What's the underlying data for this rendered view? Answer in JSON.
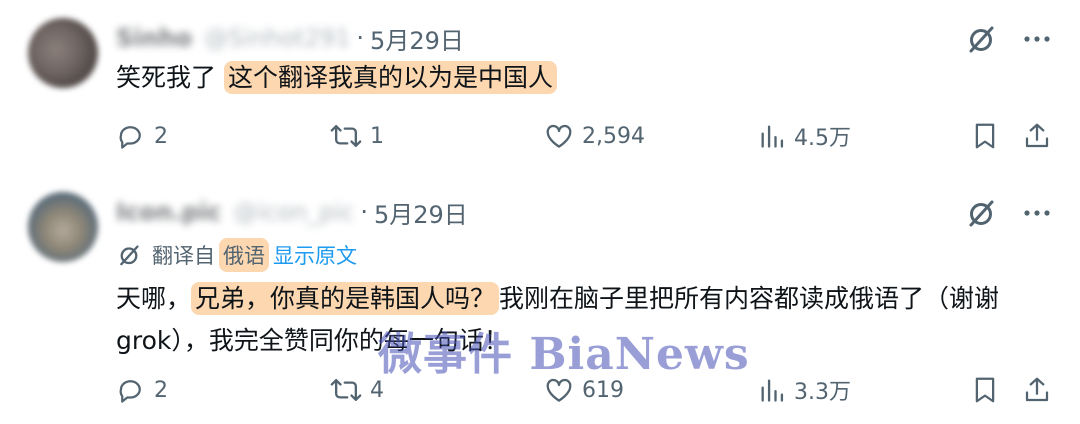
{
  "posts": [
    {
      "user_name": "Sinho",
      "user_handle": "@Sinhot291",
      "separator": "·",
      "date": "5月29日",
      "text_plain": "笑死我了",
      "text_highlight": "这个翻译我真的以为是中国人",
      "replies": "2",
      "reposts": "1",
      "likes": "2,594",
      "views": "4.5万"
    },
    {
      "user_name": "Icon.pic",
      "user_handle": "@icon_pic",
      "separator": "·",
      "date": "5月29日",
      "translation_label": "翻译自",
      "translation_lang": "俄语",
      "translation_link": "显示原文",
      "text_prefix": "天哪，",
      "text_highlight": "兄弟，你真的是韩国人吗？",
      "text_suffix": "我刚在脑子里把所有内容都读成俄语了（谢谢 grok），我完全赞同你的每一句话！",
      "replies": "2",
      "reposts": "4",
      "likes": "619",
      "views": "3.3万"
    }
  ],
  "watermark": "微事件 BiaNews",
  "icons": {
    "grok": "grok-icon",
    "more": "more-icon",
    "reply": "reply-icon",
    "repost": "repost-icon",
    "like": "heart-icon",
    "views": "views-icon",
    "bookmark": "bookmark-icon",
    "share": "share-icon"
  },
  "colors": {
    "highlight": "#fcd7b0",
    "secondary_text": "#536471",
    "link": "#1d9bf0"
  }
}
